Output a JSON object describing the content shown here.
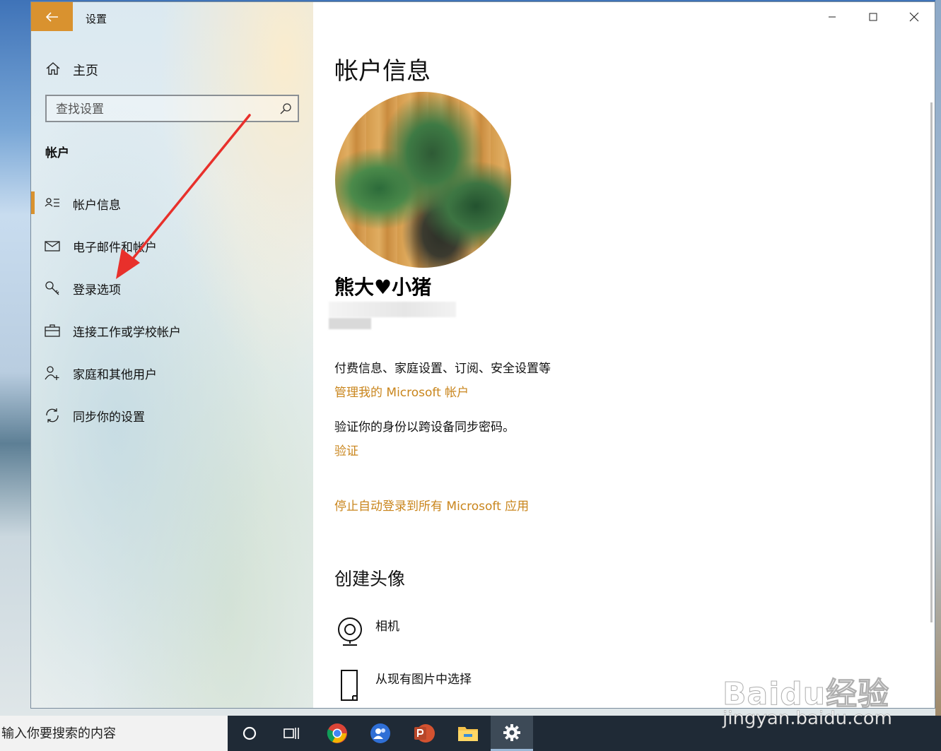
{
  "window": {
    "title": "设置"
  },
  "sidebar": {
    "home_label": "主页",
    "search_placeholder": "查找设置",
    "section_title": "帐户",
    "items": [
      {
        "label": "帐户信息",
        "icon": "account-info-icon",
        "active": true
      },
      {
        "label": "电子邮件和帐户",
        "icon": "mail-icon",
        "active": false
      },
      {
        "label": "登录选项",
        "icon": "key-icon",
        "active": false
      },
      {
        "label": "连接工作或学校帐户",
        "icon": "briefcase-icon",
        "active": false
      },
      {
        "label": "家庭和其他用户",
        "icon": "add-person-icon",
        "active": false
      },
      {
        "label": "同步你的设置",
        "icon": "sync-icon",
        "active": false
      }
    ]
  },
  "main": {
    "page_title": "帐户信息",
    "user_name": "熊大♥小猪",
    "billing_text": "付费信息、家庭设置、订阅、安全设置等",
    "manage_link": "管理我的 Microsoft 帐户",
    "verify_text": "验证你的身份以跨设备同步密码。",
    "verify_link": "验证",
    "stop_link": "停止自动登录到所有 Microsoft 应用",
    "create_avatar_title": "创建头像",
    "options": [
      {
        "label": "相机",
        "icon": "camera-icon"
      },
      {
        "label": "从现有图片中选择",
        "icon": "file-icon"
      }
    ]
  },
  "taskbar": {
    "search_placeholder": "输入你要搜索的内容",
    "apps": [
      "cortana-icon",
      "task-view-icon",
      "chrome-icon",
      "people-icon",
      "powerpoint-icon",
      "file-explorer-icon",
      "settings-gear-icon"
    ]
  },
  "watermark": {
    "brand": "Baidu经验",
    "url": "jingyan.baidu.com"
  },
  "colors": {
    "accent": "#d9922f",
    "link": "#c9851c"
  }
}
